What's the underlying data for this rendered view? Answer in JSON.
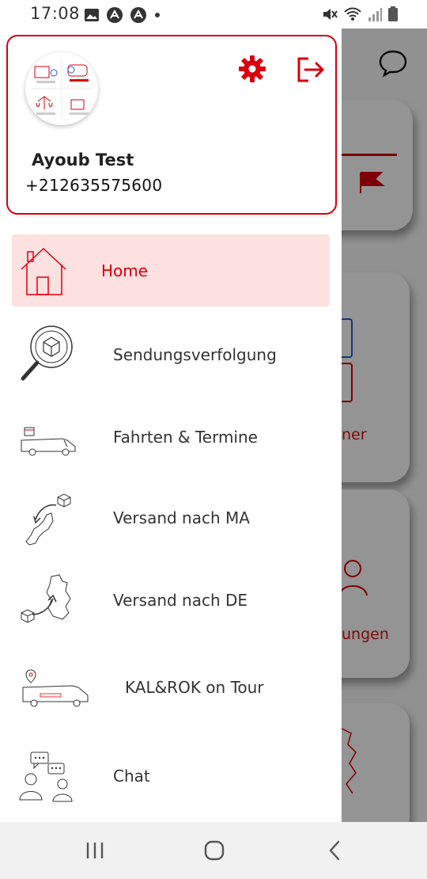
{
  "status_bar": {
    "time": "17:08"
  },
  "profile": {
    "name": "Ayoub Test",
    "phone": "+212635575600"
  },
  "colors": {
    "accent": "#d9000d",
    "active_bg": "#fde0e0"
  },
  "menu": [
    {
      "label": "Home",
      "icon": "house-icon",
      "active": true
    },
    {
      "label": "Sendungsverfolgung",
      "icon": "magnifier-package-icon",
      "active": false
    },
    {
      "label": "Fahrten & Termine",
      "icon": "van-calendar-icon",
      "active": false
    },
    {
      "label": "Versand nach MA",
      "icon": "morocco-map-package-icon",
      "active": false
    },
    {
      "label": "Versand nach DE",
      "icon": "germany-map-package-icon",
      "active": false
    },
    {
      "label": "KAL&ROK on Tour",
      "icon": "truck-location-icon",
      "active": false
    },
    {
      "label": "Chat",
      "icon": "chat-people-icon",
      "active": false
    }
  ],
  "background": {
    "partial_labels": [
      "ner",
      "ungen"
    ]
  }
}
